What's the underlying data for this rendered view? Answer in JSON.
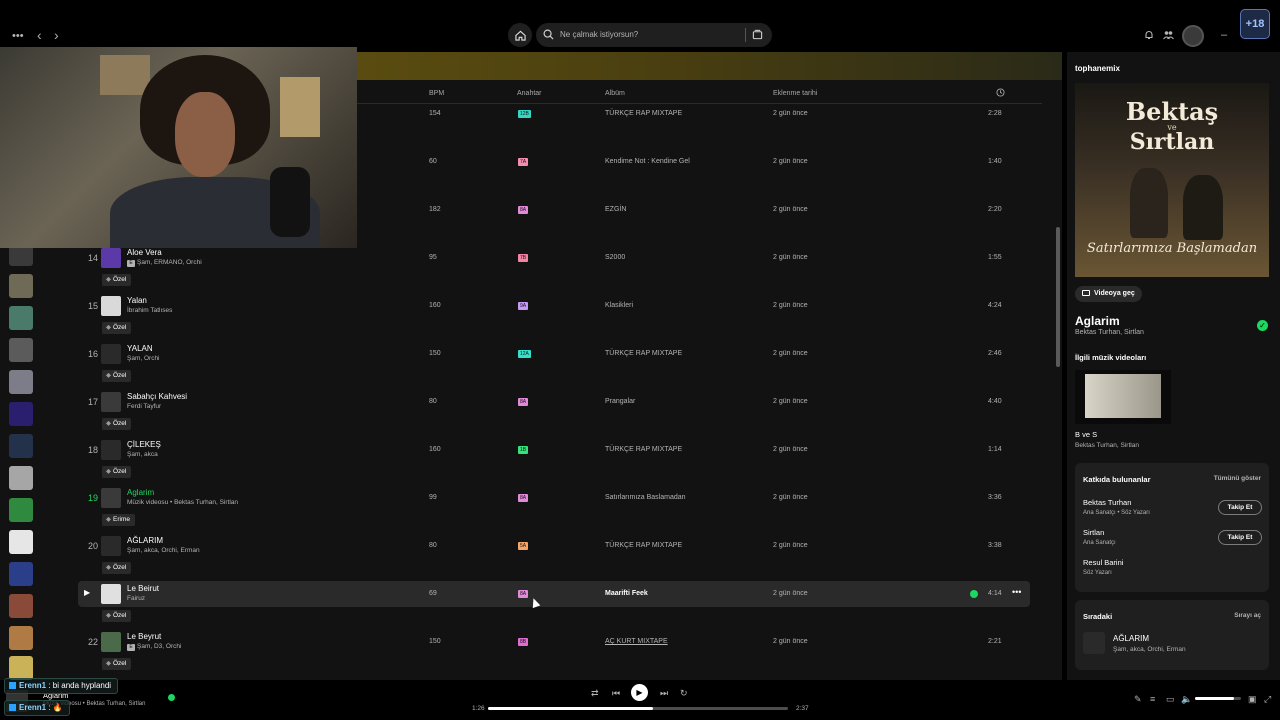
{
  "topbar": {
    "search_placeholder": "Ne çalmak istiyorsun?"
  },
  "columns": {
    "bpm": "BPM",
    "key": "Anahtar",
    "album": "Albüm",
    "added": "Eklenme tarihi"
  },
  "tracks": [
    {
      "num": "",
      "title": "",
      "artists": "",
      "explicit": false,
      "bpm": "154",
      "key": "12B",
      "key_color": "#35d6c2",
      "album": "TÜRKÇE RAP MIXTAPE",
      "added": "2 gün önce",
      "duration": "2:28",
      "tag": ""
    },
    {
      "num": "",
      "title": "",
      "artists": "",
      "explicit": false,
      "bpm": "60",
      "key": "7A",
      "key_color": "#f28fb0",
      "album": "Kendime Not : Kendine Gel",
      "added": "2 gün önce",
      "duration": "1:40",
      "tag": ""
    },
    {
      "num": "",
      "title": "",
      "artists": "",
      "explicit": false,
      "bpm": "182",
      "key": "8A",
      "key_color": "#e18ad9",
      "album": "EZGİN",
      "added": "2 gün önce",
      "duration": "2:20",
      "tag": ""
    },
    {
      "num": "14",
      "title": "Aloe Vera",
      "artists": "Şam, ERMANO, Orchi",
      "explicit": true,
      "bpm": "95",
      "key": "7B",
      "key_color": "#f285a4",
      "album": "S2000",
      "added": "2 gün önce",
      "duration": "1:55",
      "tag": "Özel"
    },
    {
      "num": "15",
      "title": "Yalan",
      "artists": "İbrahim Tatlıses",
      "explicit": false,
      "bpm": "160",
      "key": "9A",
      "key_color": "#c69af5",
      "album": "Klasikleri",
      "added": "2 gün önce",
      "duration": "4:24",
      "tag": "Özel"
    },
    {
      "num": "16",
      "title": "YALAN",
      "artists": "Şam, Orchi",
      "explicit": false,
      "bpm": "150",
      "key": "12A",
      "key_color": "#34e0c9",
      "album": "TÜRKÇE RAP MIXTAPE",
      "added": "2 gün önce",
      "duration": "2:46",
      "tag": "Özel"
    },
    {
      "num": "17",
      "title": "Sabahçı Kahvesi",
      "artists": "Ferdi Tayfur",
      "explicit": false,
      "bpm": "80",
      "key": "8A",
      "key_color": "#e18ad9",
      "album": "Prangalar",
      "added": "2 gün önce",
      "duration": "4:40",
      "tag": "Özel"
    },
    {
      "num": "18",
      "title": "ÇİLEKEŞ",
      "artists": "Şam, akca",
      "explicit": false,
      "bpm": "160",
      "key": "1B",
      "key_color": "#36e07a",
      "album": "TÜRKÇE RAP MIXTAPE",
      "added": "2 gün önce",
      "duration": "1:14",
      "tag": "Özel"
    },
    {
      "num": "19",
      "title": "Aglarim",
      "artists": "Müzik videosu • Bektas Turhan, Sirtlan",
      "explicit": false,
      "bpm": "99",
      "key": "8A",
      "key_color": "#e18ad9",
      "album": "Satırlarımıza Baslamadan",
      "added": "2 gün önce",
      "duration": "3:36",
      "tag": "Erime",
      "active": true
    },
    {
      "num": "20",
      "title": "AĞLARIM",
      "artists": "Şam, akca, Orchi, Erman",
      "explicit": false,
      "bpm": "80",
      "key": "5A",
      "key_color": "#f6a56b",
      "album": "TÜRKÇE RAP MIXTAPE",
      "added": "2 gün önce",
      "duration": "3:38",
      "tag": "Özel"
    },
    {
      "num": "",
      "title": "Le Beirut",
      "artists": "Fairuz",
      "explicit": false,
      "bpm": "69",
      "key": "8A",
      "key_color": "#e18ad9",
      "album": "Maarifti Feek",
      "added": "2 gün önce",
      "duration": "4:14",
      "tag": "Özel",
      "hover": true
    },
    {
      "num": "22",
      "title": "Le Beyrut",
      "artists": "Şam, D3, Orchi",
      "explicit": true,
      "bpm": "150",
      "key": "8B",
      "key_color": "#e06dd0",
      "album": "AÇ KURT MIXTAPE",
      "added": "2 gün önce",
      "duration": "2:21",
      "tag": "Özel"
    }
  ],
  "right_panel": {
    "header": "tophanemix",
    "cover_text_1": "Bektaş",
    "cover_text_2": "ve",
    "cover_text_3": "Sırtlan",
    "cover_text_4": "Satırlarımıza Başlamadan",
    "video_button": "Videoya geç",
    "title": "Aglarim",
    "artists": "Bektas Turhan, Sirtlan",
    "music_videos_label": "İlgili müzik videoları",
    "mv_title": "B ve S",
    "mv_artists": "Bektas Turhan, Sirtlan",
    "credits_title": "Katkıda bulunanlar",
    "credits_show_all": "Tümünü göster",
    "credits": [
      {
        "name": "Bektas Turhan",
        "role": "Ana Sanatçı • Söz Yazarı",
        "follow": "Takip Et"
      },
      {
        "name": "Sirtlan",
        "role": "Ana Sanatçı",
        "follow": "Takip Et"
      },
      {
        "name": "Resul Barini",
        "role": "Söz Yazarı",
        "follow": ""
      }
    ],
    "queue_title": "Sıradaki",
    "queue_open": "Sırayı aç",
    "queue_track_title": "AĞLARIM",
    "queue_track_artists": "Şam, akca, Orchi, Erman"
  },
  "player": {
    "now_playing_title": "Aglarim",
    "now_playing_artists": "Müzik videosu • Bektas Turhan, Sirtlan",
    "time_current": "1:26",
    "time_total": "2:37",
    "progress": 0.55,
    "volume": 0.85
  },
  "chat": [
    {
      "user": "Erenn1",
      "message": ": bi anda hyplandi"
    },
    {
      "user": "Erenn1",
      "message": ": 🔥"
    }
  ],
  "corner_badge": "+18",
  "colors": {
    "accent": "#1ed760",
    "background": "#121212"
  }
}
